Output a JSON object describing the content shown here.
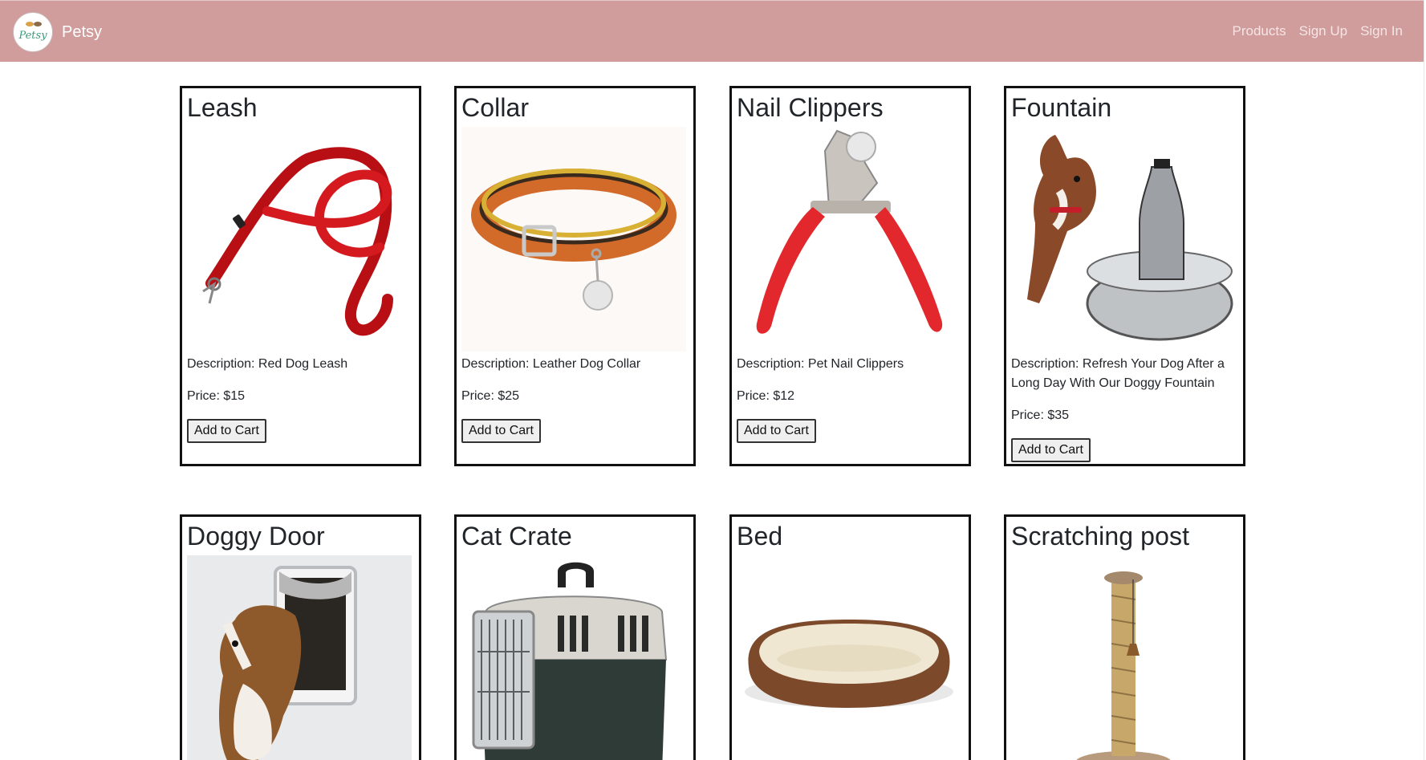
{
  "navbar": {
    "brand": "Petsy",
    "logo_text": "Petsy",
    "links": [
      "Products",
      "Sign Up",
      "Sign In"
    ]
  },
  "products": [
    {
      "title": "Leash",
      "description": "Description: Red Dog Leash",
      "price": "Price: $15",
      "button": "Add to Cart",
      "image_icon": "red-leash-image"
    },
    {
      "title": "Collar",
      "description": "Description: Leather Dog Collar",
      "price": "Price: $25",
      "button": "Add to Cart",
      "image_icon": "leather-collar-image"
    },
    {
      "title": "Nail Clippers",
      "description": "Description: Pet Nail Clippers",
      "price": "Price: $12",
      "button": "Add to Cart",
      "image_icon": "nail-clippers-image"
    },
    {
      "title": "Fountain",
      "description": "Description: Refresh Your Dog After a Long Day With Our Doggy Fountain",
      "price": "Price: $35",
      "button": "Add to Cart",
      "image_icon": "dog-fountain-image"
    },
    {
      "title": "Doggy Door",
      "description": "",
      "price": "",
      "button": "",
      "image_icon": "doggy-door-image"
    },
    {
      "title": "Cat Crate",
      "description": "",
      "price": "",
      "button": "",
      "image_icon": "cat-crate-image"
    },
    {
      "title": "Bed",
      "description": "",
      "price": "",
      "button": "",
      "image_icon": "pet-bed-image"
    },
    {
      "title": "Scratching post",
      "description": "",
      "price": "",
      "button": "",
      "image_icon": "scratching-post-image"
    }
  ],
  "colors": {
    "navbar_bg": "#d09c9c",
    "card_border": "#111111",
    "nav_link": "#f4e6e6"
  }
}
